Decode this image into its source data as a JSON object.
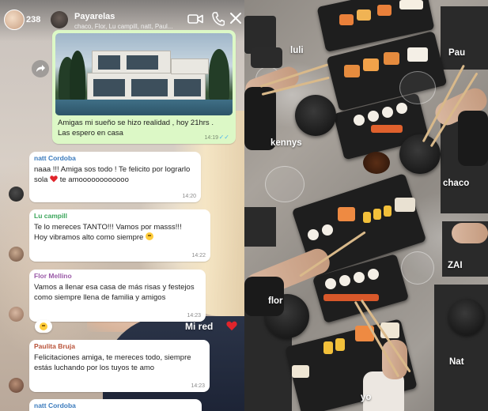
{
  "story": {
    "username": "238",
    "caption": "Mi red"
  },
  "chat": {
    "name": "Payarelas",
    "members": "chaco, Flor, Lu campill, natt, Paul..."
  },
  "outgoing": {
    "text": "Amigas mi sueño se hizo realidad , hoy 21hrs . Las espero en casa",
    "time": "14:19"
  },
  "messages": [
    {
      "sender": "natt Cordoba",
      "sender_color": "#3b7bbd",
      "text": "naaa !!! Amiga sos todo ! Te felicito por lograrlo sola",
      "text_after_heart": " te amoooooooooooo",
      "time": "14:20"
    },
    {
      "sender": "Lu campill",
      "sender_color": "#3aa55a",
      "text": "Te lo mereces TANTO!!! Vamos por masss!!! Hoy vibramos alto como siempre",
      "time": "14:22"
    },
    {
      "sender": "Flor Mellino",
      "sender_color": "#9a5aa8",
      "text": "Vamos a llenar esa casa de más risas y festejos como siempre llena de familia y amigos",
      "time": "14:23"
    },
    {
      "sender": "Paulita Bruja",
      "sender_color": "#b9533a",
      "text": "Felicitaciones amiga, te mereces todo, siempre estás luchando por los tuyos te amo",
      "time": "14:23"
    },
    {
      "sender": "natt Cordoba",
      "sender_color": "#3b7bbd"
    }
  ],
  "photo_labels": [
    "luli",
    "Pau",
    "kennys",
    "chaco",
    "ZAI",
    "flor",
    "Nat",
    "yo"
  ],
  "colors": {
    "whatsapp_out": "#dcf8c6",
    "heart_red": "#e0242b",
    "read_ticks": "#4fb6ec"
  },
  "icons": [
    "video-call-icon",
    "phone-icon",
    "close-icon",
    "forward-icon",
    "heart-icon",
    "smile-emoji-icon"
  ]
}
